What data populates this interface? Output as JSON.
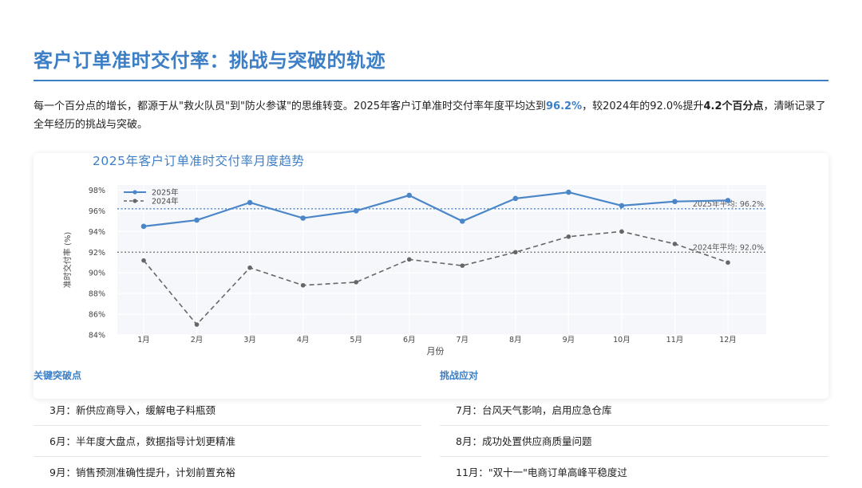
{
  "page": {
    "title": "客户订单准时交付率：挑战与突破的轨迹",
    "intro": {
      "p1": "每一个百分点的增长，都源于从\"救火队员\"到\"防火参谋\"的思维转变。2025年客户订单准时交付率年度平均达到",
      "v1": "96.2%",
      "p2": "，较2024年的92.0%提升",
      "v2": "4.2个百分点",
      "p3": "，清晰记录了全年经历的挑战与突破。"
    }
  },
  "chart_data": {
    "type": "line",
    "title": "2025年客户订单准时交付率月度趋势",
    "xlabel": "月份",
    "ylabel": "准时交付率 (%)",
    "categories": [
      "1月",
      "2月",
      "3月",
      "4月",
      "5月",
      "6月",
      "7月",
      "8月",
      "9月",
      "10月",
      "11月",
      "12月"
    ],
    "ylim": [
      84,
      98.5
    ],
    "yticks": [
      84,
      86,
      88,
      90,
      92,
      94,
      96,
      98
    ],
    "ytick_labels": [
      "84%",
      "86%",
      "88%",
      "90%",
      "92%",
      "94%",
      "96%",
      "98%"
    ],
    "grid": true,
    "legend_position": "top-left",
    "series": [
      {
        "name": "2025年",
        "color": "#4a86c8",
        "dash": false,
        "values": [
          94.5,
          95.1,
          96.8,
          95.3,
          96.0,
          97.5,
          95.0,
          97.2,
          97.8,
          96.5,
          96.9,
          97.0
        ]
      },
      {
        "name": "2024年",
        "color": "#666666",
        "dash": true,
        "values": [
          91.2,
          85.0,
          90.5,
          88.8,
          89.1,
          91.3,
          90.7,
          92.0,
          93.5,
          94.0,
          92.8,
          91.0
        ]
      }
    ],
    "reference_lines": [
      {
        "value": 96.2,
        "label": "2025年平均: 96.2%",
        "color": "#4a86c8"
      },
      {
        "value": 92.0,
        "label": "2024年平均: 92.0%",
        "color": "#666666"
      }
    ]
  },
  "breakthroughs": {
    "heading": "关键突破点",
    "items": [
      "3月：新供应商导入，缓解电子料瓶颈",
      "6月：半年度大盘点，数据指导计划更精准",
      "9月：销售预测准确性提升，计划前置充裕"
    ]
  },
  "challenges": {
    "heading": "挑战应对",
    "items": [
      "7月：台风天气影响，启用应急仓库",
      "8月：成功处置供应商质量问题",
      "11月：\"双十一\"电商订单高峰平稳度过"
    ]
  }
}
